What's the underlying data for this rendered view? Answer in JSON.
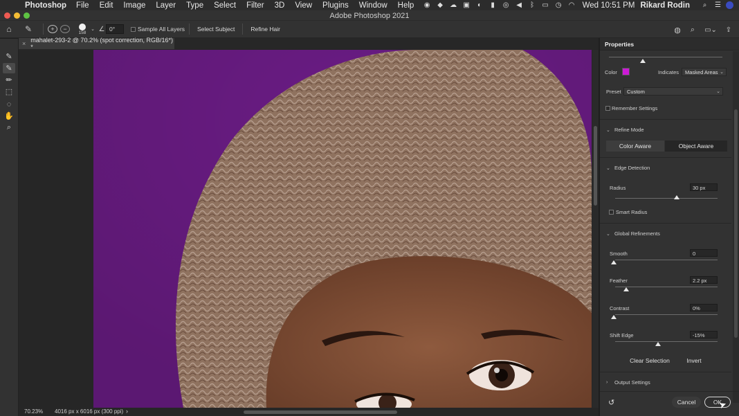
{
  "menubar": {
    "app": "Photoshop",
    "items": [
      "File",
      "Edit",
      "Image",
      "Layer",
      "Type",
      "Select",
      "Filter",
      "3D",
      "View",
      "Plugins",
      "Window",
      "Help"
    ],
    "clock": "Wed 10:51 PM",
    "user": "Rikard Rodin"
  },
  "window": {
    "title": "Adobe Photoshop 2021"
  },
  "options": {
    "brush_size": "158",
    "angle": "0°",
    "sample_all_layers": "Sample All Layers",
    "select_subject": "Select Subject",
    "refine_hair": "Refine Hair"
  },
  "document": {
    "tab_title": "mahalet-293-2 @ 70.2% (spot correction, RGB/16*) *",
    "zoom": "70.23%",
    "info": "4016 px x 6016 px (300 ppi)"
  },
  "panel": {
    "title": "Properties",
    "color_label": "Color",
    "color_value": "#cc1ad6",
    "indicates_label": "Indicates",
    "indicates_value": "Masked Areas",
    "preset_label": "Preset",
    "preset_value": "Custom",
    "remember_settings": "Remember Settings",
    "refine_mode": "Refine Mode",
    "color_aware": "Color Aware",
    "object_aware": "Object Aware",
    "edge_detection": "Edge Detection",
    "radius_label": "Radius",
    "radius_value": "30 px",
    "radius_level": 0.6,
    "smart_radius": "Smart Radius",
    "global_refinements": "Global Refinements",
    "smooth_label": "Smooth",
    "smooth_value": "0",
    "feather_label": "Feather",
    "feather_value": "2.2 px",
    "contrast_label": "Contrast",
    "contrast_value": "0%",
    "shift_edge_label": "Shift Edge",
    "shift_edge_value": "-15%",
    "clear_selection": "Clear Selection",
    "invert": "Invert",
    "output_settings": "Output Settings",
    "cancel": "Cancel",
    "ok": "OK"
  },
  "tools": [
    "quick-selection-icon",
    "refine-edge-brush-icon",
    "brush-icon",
    "object-selection-icon",
    "lasso-icon",
    "hand-icon",
    "zoom-icon"
  ]
}
